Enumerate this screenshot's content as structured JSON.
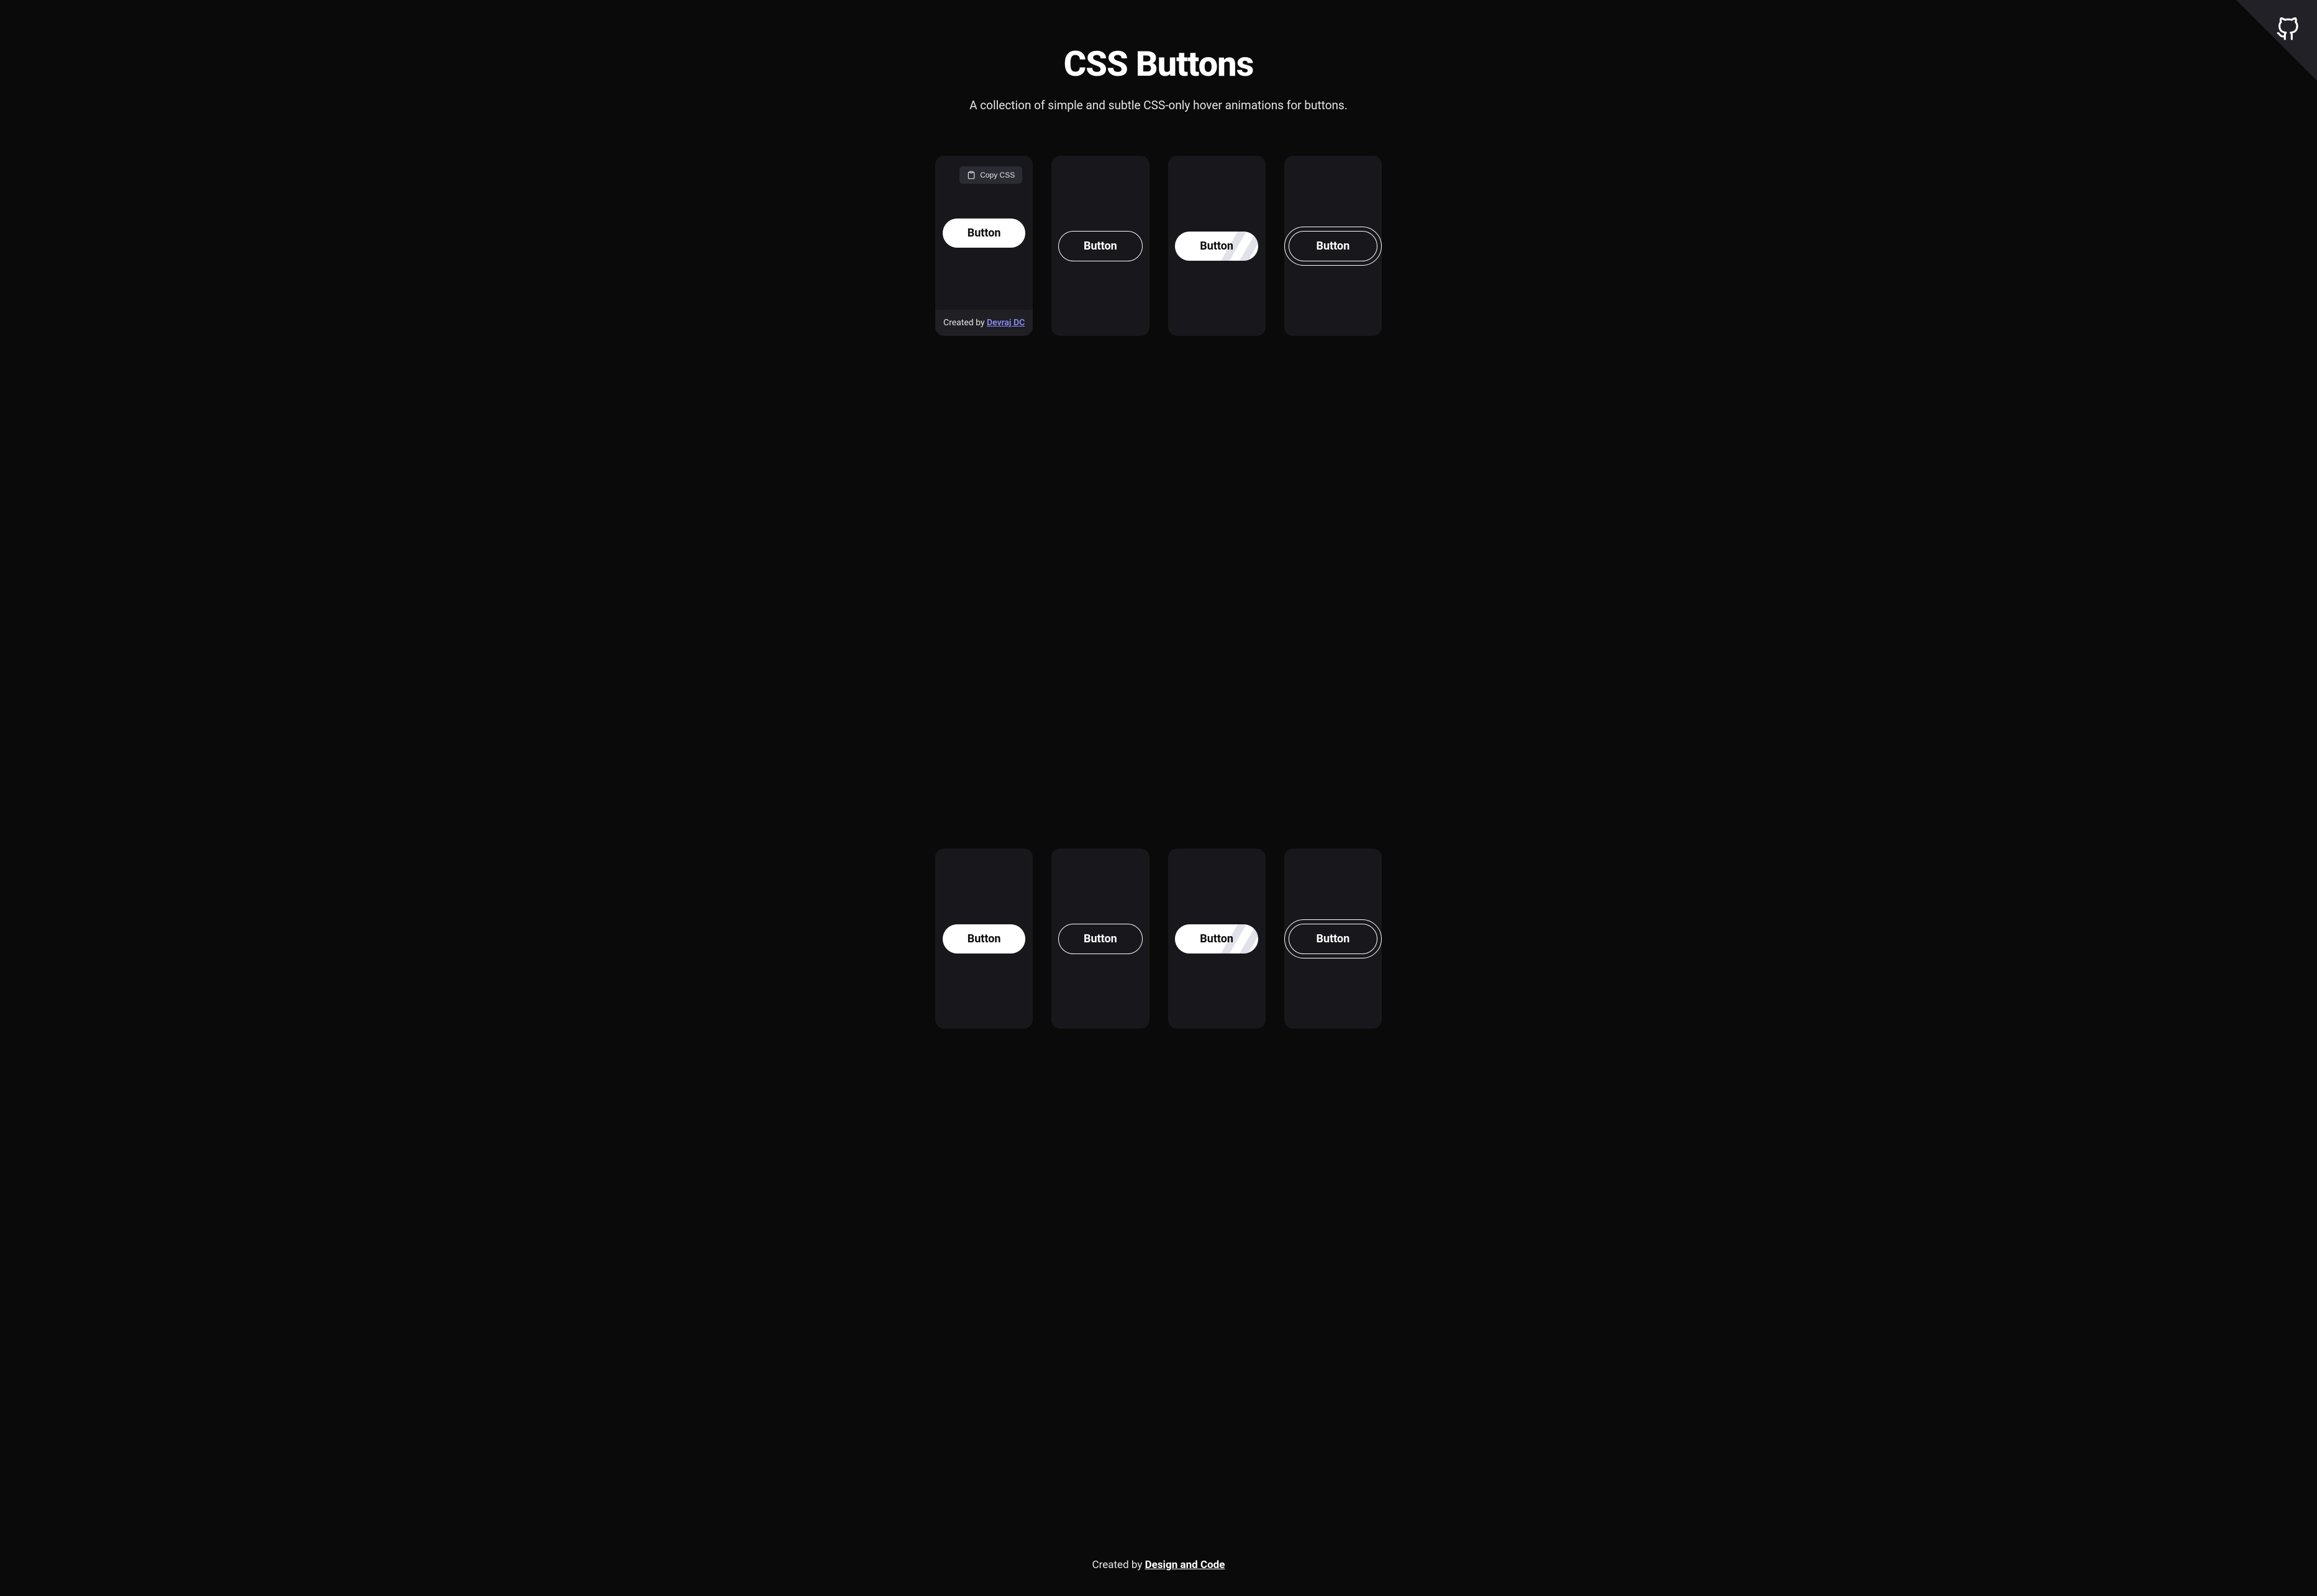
{
  "header": {
    "title": "CSS Buttons",
    "subtitle": "A collection of simple and subtle CSS-only hover animations for buttons."
  },
  "copyButton": {
    "label": "Copy CSS"
  },
  "cards": [
    {
      "buttonLabel": "Button",
      "showCopy": true,
      "showFooter": true,
      "style": "solid"
    },
    {
      "buttonLabel": "Button",
      "showCopy": false,
      "showFooter": false,
      "style": "outline"
    },
    {
      "buttonLabel": "Button",
      "showCopy": false,
      "showFooter": false,
      "style": "stripes"
    },
    {
      "buttonLabel": "Button",
      "showCopy": false,
      "showFooter": false,
      "style": "double-outline"
    },
    {
      "buttonLabel": "Button",
      "showCopy": false,
      "showFooter": false,
      "style": "solid"
    },
    {
      "buttonLabel": "Button",
      "showCopy": false,
      "showFooter": false,
      "style": "outline"
    },
    {
      "buttonLabel": "Button",
      "showCopy": false,
      "showFooter": false,
      "style": "stripes"
    },
    {
      "buttonLabel": "Button",
      "showCopy": false,
      "showFooter": false,
      "style": "double-outline"
    }
  ],
  "cardFooter": {
    "createdBy": "Created by ",
    "author": "Devraj DC"
  },
  "footer": {
    "createdBy": "Created by ",
    "brand": "Design and Code"
  }
}
